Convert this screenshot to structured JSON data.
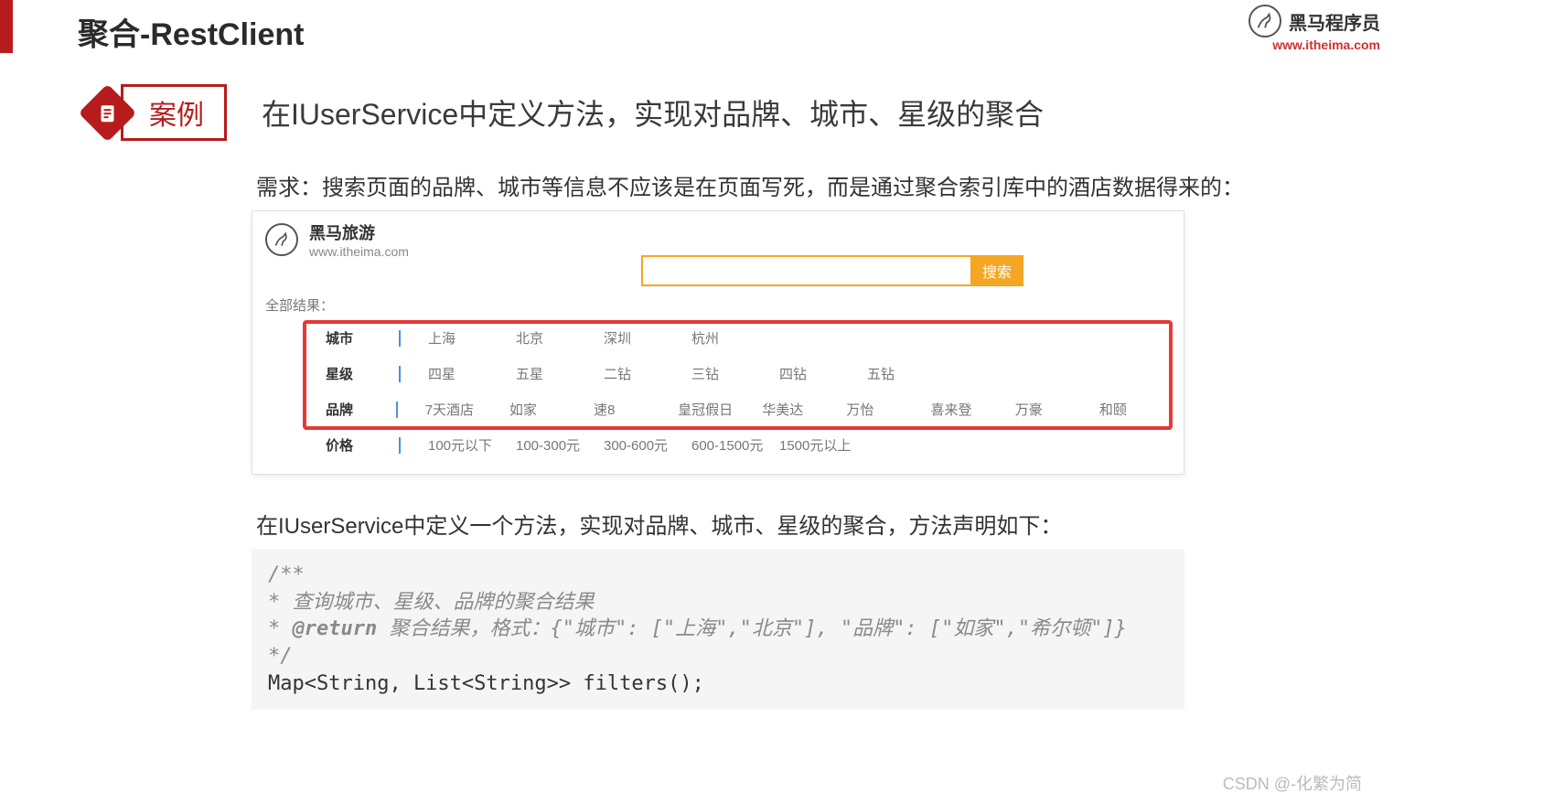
{
  "header": {
    "title": "聚合-RestClient",
    "logo_text": "黑马程序员",
    "logo_url": "www.itheima.com"
  },
  "case": {
    "badge": "案例",
    "heading": "在IUserService中定义方法，实现对品牌、城市、星级的聚合"
  },
  "req": {
    "label": "需求：",
    "text": "搜索页面的品牌、城市等信息不应该是在页面写死，而是通过聚合索引库中的酒店数据得来的："
  },
  "panel": {
    "brand_cn": "黑马旅游",
    "brand_url": "www.itheima.com",
    "search_placeholder": "",
    "search_btn": "搜索",
    "all_results": "全部结果：",
    "filters": [
      {
        "label": "城市",
        "options": [
          "上海",
          "北京",
          "深圳",
          "杭州"
        ]
      },
      {
        "label": "星级",
        "options": [
          "四星",
          "五星",
          "二钻",
          "三钻",
          "四钻",
          "五钻"
        ]
      },
      {
        "label": "品牌",
        "options": [
          "7天酒店",
          "如家",
          "速8",
          "皇冠假日",
          "华美达",
          "万怡",
          "喜来登",
          "万豪",
          "和颐"
        ]
      },
      {
        "label": "价格",
        "options": [
          "100元以下",
          "100-300元",
          "300-600元",
          "600-1500元",
          "1500元以上"
        ]
      }
    ]
  },
  "method": {
    "desc": "在IUserService中定义一个方法，实现对品牌、城市、星级的聚合，方法声明如下："
  },
  "code": {
    "l1": "/**",
    "l2": " *  查询城市、星级、品牌的聚合结果",
    "l3_a": " * ",
    "l3_b": "@return",
    "l3_c": " 聚合结果，格式：{\"城市\": [\"上海\",\"北京\"], \"品牌\": [\"如家\",\"希尔顿\"]}",
    "l4": " */",
    "l5": "Map<String, List<String>> filters();"
  },
  "footer": "CSDN @-化繁为简"
}
